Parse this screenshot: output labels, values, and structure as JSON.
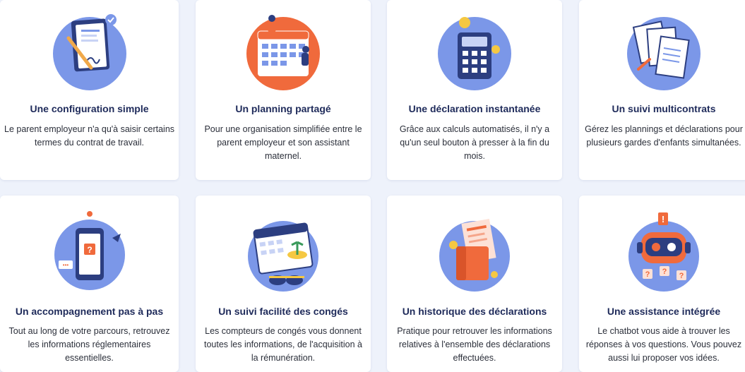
{
  "features": [
    {
      "title": "Une configuration simple",
      "description": "Le parent employeur n'a qu'à saisir certains termes du contrat de travail.",
      "icon": "contract-signature-icon"
    },
    {
      "title": "Un planning partagé",
      "description": "Pour une organisation simplifiée entre le parent employeur et son assistant maternel.",
      "icon": "shared-calendar-icon"
    },
    {
      "title": "Une déclaration instantanée",
      "description": "Grâce aux calculs automatisés, il n'y a qu'un seul bouton à presser à la fin du mois.",
      "icon": "calculator-icon"
    },
    {
      "title": "Un suivi multicontrats",
      "description": "Gérez les plannings et déclarations pour plusieurs gardes d'enfants simultanées.",
      "icon": "documents-stack-icon"
    },
    {
      "title": "Un accompagnement pas à pas",
      "description": "Tout au long de votre parcours, retrouvez les informations réglementaires essentielles.",
      "icon": "phone-question-icon"
    },
    {
      "title": "Un suivi facilité des congés",
      "description": "Les compteurs de congés vous donnent toutes les informations, de l'acquisition à la rémunération.",
      "icon": "vacation-calendar-icon"
    },
    {
      "title": "Un historique des déclarations",
      "description": "Pratique pour retrouver les informations relatives à l'ensemble des déclarations effectuées.",
      "icon": "history-folder-icon"
    },
    {
      "title": "Une assistance intégrée",
      "description": "Le chatbot vous aide à trouver les réponses à vos questions. Vous pouvez aussi lui proposer vos idées.",
      "icon": "chatbot-icon"
    }
  ],
  "colors": {
    "page_background": "#eef2fb",
    "card_background": "#ffffff",
    "title": "#1e2a5a",
    "illustration_circle": "#7b97e8",
    "accent_orange": "#f06a3c",
    "accent_navy": "#2c3e80"
  }
}
